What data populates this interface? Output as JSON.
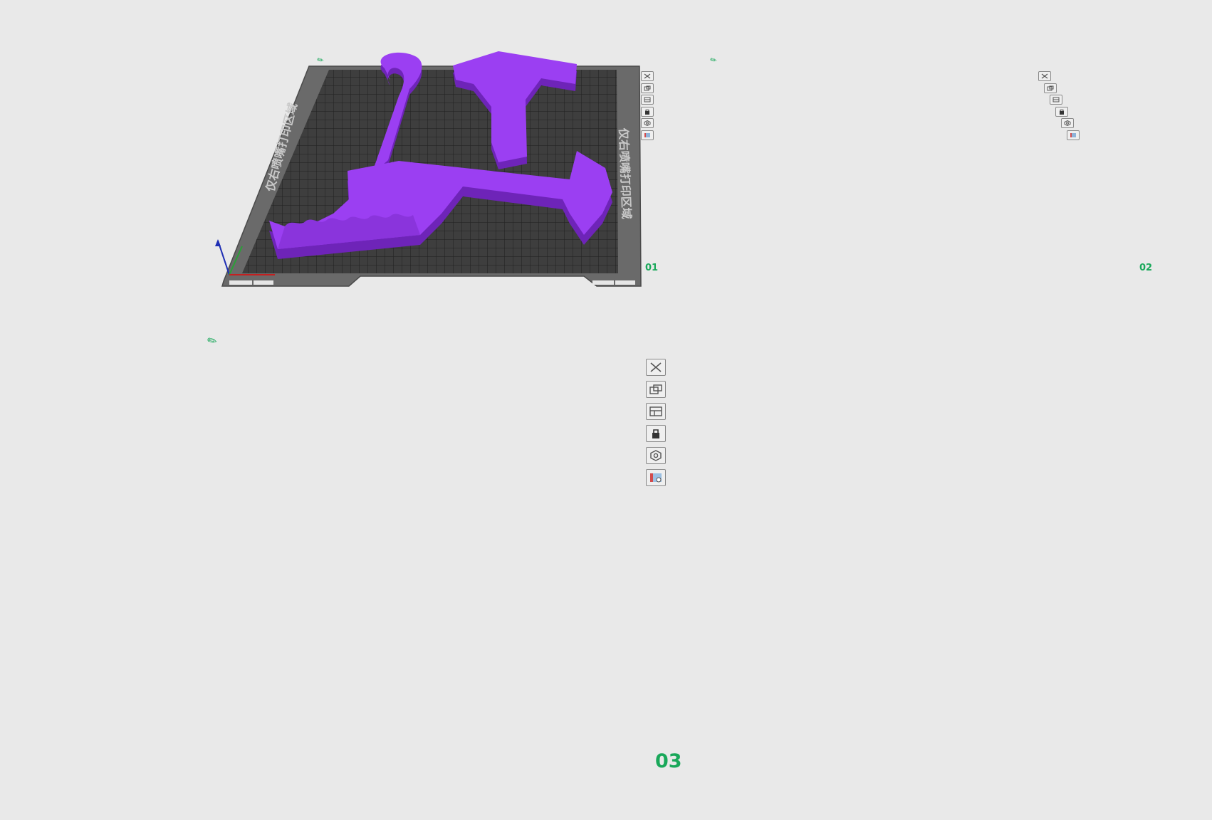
{
  "plates": [
    {
      "label": "01",
      "bed": "textured-dark-with-frame"
    },
    {
      "label": "02",
      "bed": "plain-light"
    },
    {
      "label": "03",
      "bed": "plain-light"
    }
  ],
  "plate_toolbar": [
    "close-icon",
    "arrange-icon",
    "orient-icon",
    "lock-icon",
    "settings-icon",
    "slice-icon"
  ],
  "plate_edit_icon": "pencil-icon",
  "plate1_bed_text": "仅右喷嘴打印区域",
  "colors": {
    "background": "#e9e9e9",
    "model_top": "#9b3ff2",
    "model_side": "#6e24b8",
    "label_green": "#19a85a",
    "light_bed": "#d9d9d9",
    "dark_bed": "#3e3e3e"
  }
}
